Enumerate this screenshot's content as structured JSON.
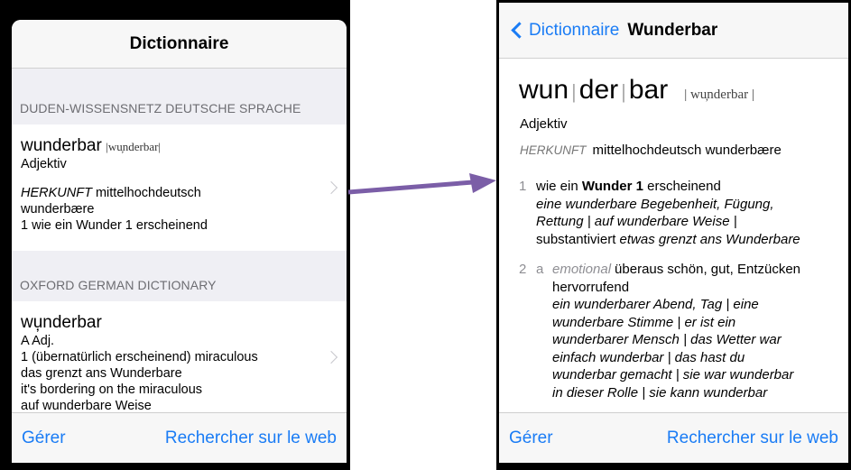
{
  "left": {
    "title": "Dictionnaire",
    "sections": [
      {
        "header": "DUDEN-WISSENSNETZ DEUTSCHE SPRACHE",
        "word": "wunderbar",
        "phonetic": "|wu̦nderbar|",
        "pos": "Adjektiv",
        "herkunft_label": "HERKUNFT",
        "herkunft_text": " mittelhochdeutsch",
        "line3": "wunderbære",
        "line4": "1 wie ein Wunder 1 erscheinend"
      },
      {
        "header": "OXFORD GERMAN DICTIONARY",
        "word": "wu̦nderbar",
        "line1": "A Adj.",
        "line2": "1 (übernatürlich erscheinend) miraculous",
        "line3": "das grenzt ans Wunderbare",
        "line4": "it's bordering on the miraculous",
        "line5": "auf wunderbare Weise"
      }
    ],
    "toolbar": {
      "manage": "Gérer",
      "search_web": "Rechercher sur le web"
    }
  },
  "right": {
    "back_label": "Dictionnaire",
    "nav_title": "Wunderbar",
    "headword": {
      "syl1": "wun",
      "syl2": "der",
      "syl3": "bar",
      "sep": "|",
      "phonetic": "| wu̦nderbar |"
    },
    "pos": "Adjektiv",
    "herkunft_label": "HERKUNFT",
    "herkunft_text": "mittelhochdeutsch wunderbære",
    "sense1": {
      "num": "1",
      "def_pre": "wie ein ",
      "def_bold": "Wunder 1",
      "def_post": " erscheinend",
      "ex1": "eine wunderbare Begebenheit, Fügung,",
      "ex2": "Rettung | auf wunderbare Weise |",
      "ex3_plain": "substantiviert ",
      "ex3_it": "etwas grenzt ans Wunderbare"
    },
    "sense2": {
      "num": "2",
      "sub": "a",
      "label": "emotional",
      "def1": "überaus schön, gut, Entzücken",
      "def2": "hervorrufend",
      "ex1": "ein wunderbarer Abend, Tag | eine",
      "ex2": "wunderbare Stimme | er ist ein",
      "ex3": "wunderbarer Mensch | das Wetter war",
      "ex4": "einfach wunderbar | das hast du",
      "ex5": "wunderbar gemacht | sie war wunderbar",
      "ex6": "in dieser Rolle | sie kann wunderbar"
    },
    "toolbar": {
      "manage": "Gérer",
      "search_web": "Rechercher sur le web"
    }
  },
  "colors": {
    "accent": "#1a7cf5",
    "arrow": "#7b5ea7",
    "section_bg": "#efeff4"
  },
  "icons": [
    "chevron-right-icon",
    "chevron-left-icon",
    "arrow-right-icon"
  ]
}
